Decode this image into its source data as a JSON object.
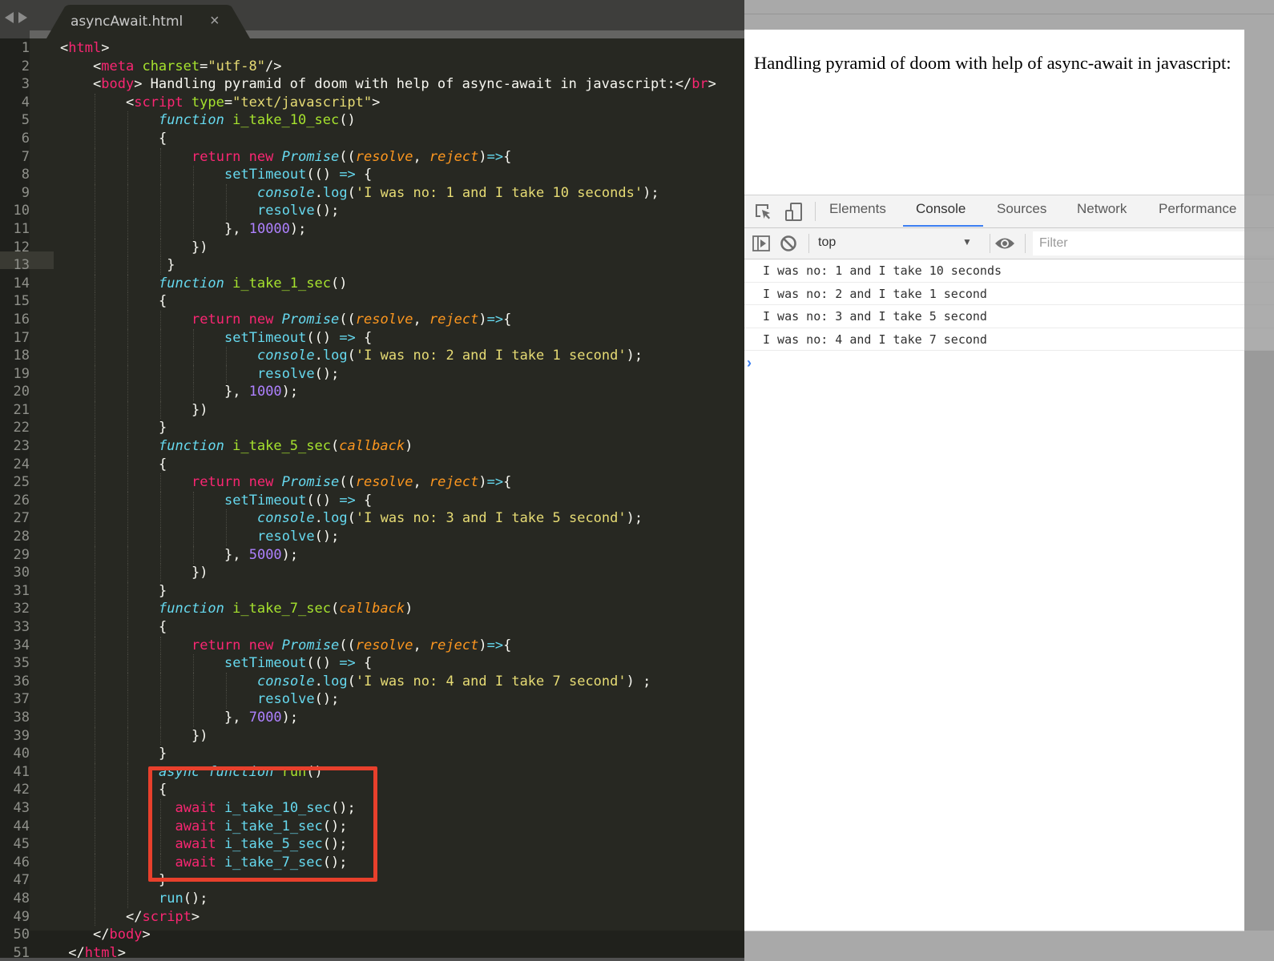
{
  "editor": {
    "tab_title": "asyncAwait.html",
    "tab_close_icon": "×",
    "lines": [
      {
        "n": "1",
        "indent": 0,
        "tokens": [
          [
            "pun",
            "<"
          ],
          [
            "tag",
            "html"
          ],
          [
            "pun",
            ">"
          ]
        ]
      },
      {
        "n": "2",
        "indent": 4,
        "tokens": [
          [
            "pun",
            "<"
          ],
          [
            "tag",
            "meta"
          ],
          [
            "pun",
            " "
          ],
          [
            "attr",
            "charset"
          ],
          [
            "pun",
            "="
          ],
          [
            "str",
            "\"utf-8\""
          ],
          [
            "pun",
            "/>"
          ]
        ]
      },
      {
        "n": "3",
        "indent": 4,
        "tokens": [
          [
            "pun",
            "<"
          ],
          [
            "tag",
            "body"
          ],
          [
            "pun",
            "> Handling pyramid of doom with help of async-await in javascript:</"
          ],
          [
            "tag",
            "br"
          ],
          [
            "pun",
            ">"
          ]
        ]
      },
      {
        "n": "4",
        "indent": 8,
        "tokens": [
          [
            "pun",
            "<"
          ],
          [
            "tag",
            "script"
          ],
          [
            "pun",
            " "
          ],
          [
            "attr",
            "type"
          ],
          [
            "pun",
            "="
          ],
          [
            "str",
            "\"text/javascript\""
          ],
          [
            "pun",
            ">"
          ]
        ]
      },
      {
        "n": "5",
        "indent": 12,
        "tokens": [
          [
            "sto",
            "function"
          ],
          [
            "pun",
            " "
          ],
          [
            "fn",
            "i_take_10_sec"
          ],
          [
            "pun",
            "()"
          ]
        ]
      },
      {
        "n": "6",
        "indent": 12,
        "tokens": [
          [
            "pun",
            "{"
          ]
        ]
      },
      {
        "n": "7",
        "indent": 16,
        "tokens": [
          [
            "kw",
            "return"
          ],
          [
            "pun",
            " "
          ],
          [
            "kw",
            "new"
          ],
          [
            "pun",
            " "
          ],
          [
            "cls",
            "Promise"
          ],
          [
            "pun",
            "(("
          ],
          [
            "param",
            "resolve"
          ],
          [
            "pun",
            ", "
          ],
          [
            "param",
            "reject"
          ],
          [
            "pun",
            ")"
          ],
          [
            "arrow",
            "=>"
          ],
          [
            "pun",
            "{"
          ]
        ]
      },
      {
        "n": "8",
        "indent": 20,
        "tokens": [
          [
            "call",
            "setTimeout"
          ],
          [
            "pun",
            "(() "
          ],
          [
            "arrow",
            "=>"
          ],
          [
            "pun",
            " {"
          ]
        ]
      },
      {
        "n": "9",
        "indent": 24,
        "tokens": [
          [
            "sto",
            "console"
          ],
          [
            "pun",
            "."
          ],
          [
            "call",
            "log"
          ],
          [
            "pun",
            "("
          ],
          [
            "str",
            "'I was no: 1 and I take 10 seconds'"
          ],
          [
            "pun",
            ");"
          ]
        ]
      },
      {
        "n": "10",
        "indent": 24,
        "tokens": [
          [
            "call",
            "resolve"
          ],
          [
            "pun",
            "();"
          ]
        ]
      },
      {
        "n": "11",
        "indent": 20,
        "tokens": [
          [
            "pun",
            "}, "
          ],
          [
            "num",
            "10000"
          ],
          [
            "pun",
            ");"
          ]
        ]
      },
      {
        "n": "12",
        "indent": 16,
        "tokens": [
          [
            "pun",
            "})"
          ]
        ]
      },
      {
        "n": "13",
        "indent": 13,
        "tokens": [
          [
            "pun",
            "}"
          ]
        ]
      },
      {
        "n": "14",
        "indent": 12,
        "tokens": [
          [
            "sto",
            "function"
          ],
          [
            "pun",
            " "
          ],
          [
            "fn",
            "i_take_1_sec"
          ],
          [
            "pun",
            "()"
          ]
        ]
      },
      {
        "n": "15",
        "indent": 12,
        "tokens": [
          [
            "pun",
            "{"
          ]
        ]
      },
      {
        "n": "16",
        "indent": 16,
        "tokens": [
          [
            "kw",
            "return"
          ],
          [
            "pun",
            " "
          ],
          [
            "kw",
            "new"
          ],
          [
            "pun",
            " "
          ],
          [
            "cls",
            "Promise"
          ],
          [
            "pun",
            "(("
          ],
          [
            "param",
            "resolve"
          ],
          [
            "pun",
            ", "
          ],
          [
            "param",
            "reject"
          ],
          [
            "pun",
            ")"
          ],
          [
            "arrow",
            "=>"
          ],
          [
            "pun",
            "{"
          ]
        ]
      },
      {
        "n": "17",
        "indent": 20,
        "tokens": [
          [
            "call",
            "setTimeout"
          ],
          [
            "pun",
            "(() "
          ],
          [
            "arrow",
            "=>"
          ],
          [
            "pun",
            " {"
          ]
        ]
      },
      {
        "n": "18",
        "indent": 24,
        "tokens": [
          [
            "sto",
            "console"
          ],
          [
            "pun",
            "."
          ],
          [
            "call",
            "log"
          ],
          [
            "pun",
            "("
          ],
          [
            "str",
            "'I was no: 2 and I take 1 second'"
          ],
          [
            "pun",
            ");"
          ]
        ]
      },
      {
        "n": "19",
        "indent": 24,
        "tokens": [
          [
            "call",
            "resolve"
          ],
          [
            "pun",
            "();"
          ]
        ]
      },
      {
        "n": "20",
        "indent": 20,
        "tokens": [
          [
            "pun",
            "}, "
          ],
          [
            "num",
            "1000"
          ],
          [
            "pun",
            ");"
          ]
        ]
      },
      {
        "n": "21",
        "indent": 16,
        "tokens": [
          [
            "pun",
            "})"
          ]
        ]
      },
      {
        "n": "22",
        "indent": 12,
        "tokens": [
          [
            "pun",
            "}"
          ]
        ]
      },
      {
        "n": "23",
        "indent": 12,
        "tokens": [
          [
            "sto",
            "function"
          ],
          [
            "pun",
            " "
          ],
          [
            "fn",
            "i_take_5_sec"
          ],
          [
            "pun",
            "("
          ],
          [
            "param",
            "callback"
          ],
          [
            "pun",
            ")"
          ]
        ]
      },
      {
        "n": "24",
        "indent": 12,
        "tokens": [
          [
            "pun",
            "{"
          ]
        ]
      },
      {
        "n": "25",
        "indent": 16,
        "tokens": [
          [
            "kw",
            "return"
          ],
          [
            "pun",
            " "
          ],
          [
            "kw",
            "new"
          ],
          [
            "pun",
            " "
          ],
          [
            "cls",
            "Promise"
          ],
          [
            "pun",
            "(("
          ],
          [
            "param",
            "resolve"
          ],
          [
            "pun",
            ", "
          ],
          [
            "param",
            "reject"
          ],
          [
            "pun",
            ")"
          ],
          [
            "arrow",
            "=>"
          ],
          [
            "pun",
            "{"
          ]
        ]
      },
      {
        "n": "26",
        "indent": 20,
        "tokens": [
          [
            "call",
            "setTimeout"
          ],
          [
            "pun",
            "(() "
          ],
          [
            "arrow",
            "=>"
          ],
          [
            "pun",
            " {"
          ]
        ]
      },
      {
        "n": "27",
        "indent": 24,
        "tokens": [
          [
            "sto",
            "console"
          ],
          [
            "pun",
            "."
          ],
          [
            "call",
            "log"
          ],
          [
            "pun",
            "("
          ],
          [
            "str",
            "'I was no: 3 and I take 5 second'"
          ],
          [
            "pun",
            ");"
          ]
        ]
      },
      {
        "n": "28",
        "indent": 24,
        "tokens": [
          [
            "call",
            "resolve"
          ],
          [
            "pun",
            "();"
          ]
        ]
      },
      {
        "n": "29",
        "indent": 20,
        "tokens": [
          [
            "pun",
            "}, "
          ],
          [
            "num",
            "5000"
          ],
          [
            "pun",
            ");"
          ]
        ]
      },
      {
        "n": "30",
        "indent": 16,
        "tokens": [
          [
            "pun",
            "})"
          ]
        ]
      },
      {
        "n": "31",
        "indent": 12,
        "tokens": [
          [
            "pun",
            "}"
          ]
        ]
      },
      {
        "n": "32",
        "indent": 12,
        "tokens": [
          [
            "sto",
            "function"
          ],
          [
            "pun",
            " "
          ],
          [
            "fn",
            "i_take_7_sec"
          ],
          [
            "pun",
            "("
          ],
          [
            "param",
            "callback"
          ],
          [
            "pun",
            ")"
          ]
        ]
      },
      {
        "n": "33",
        "indent": 12,
        "tokens": [
          [
            "pun",
            "{"
          ]
        ]
      },
      {
        "n": "34",
        "indent": 16,
        "tokens": [
          [
            "kw",
            "return"
          ],
          [
            "pun",
            " "
          ],
          [
            "kw",
            "new"
          ],
          [
            "pun",
            " "
          ],
          [
            "cls",
            "Promise"
          ],
          [
            "pun",
            "(("
          ],
          [
            "param",
            "resolve"
          ],
          [
            "pun",
            ", "
          ],
          [
            "param",
            "reject"
          ],
          [
            "pun",
            ")"
          ],
          [
            "arrow",
            "=>"
          ],
          [
            "pun",
            "{"
          ]
        ]
      },
      {
        "n": "35",
        "indent": 20,
        "tokens": [
          [
            "call",
            "setTimeout"
          ],
          [
            "pun",
            "(() "
          ],
          [
            "arrow",
            "=>"
          ],
          [
            "pun",
            " {"
          ]
        ]
      },
      {
        "n": "36",
        "indent": 24,
        "tokens": [
          [
            "sto",
            "console"
          ],
          [
            "pun",
            "."
          ],
          [
            "call",
            "log"
          ],
          [
            "pun",
            "("
          ],
          [
            "str",
            "'I was no: 4 and I take 7 second'"
          ],
          [
            "pun",
            ") ;"
          ]
        ]
      },
      {
        "n": "37",
        "indent": 24,
        "tokens": [
          [
            "call",
            "resolve"
          ],
          [
            "pun",
            "();"
          ]
        ]
      },
      {
        "n": "38",
        "indent": 20,
        "tokens": [
          [
            "pun",
            "}, "
          ],
          [
            "num",
            "7000"
          ],
          [
            "pun",
            ");"
          ]
        ]
      },
      {
        "n": "39",
        "indent": 16,
        "tokens": [
          [
            "pun",
            "})"
          ]
        ]
      },
      {
        "n": "40",
        "indent": 12,
        "tokens": [
          [
            "pun",
            "}"
          ]
        ]
      },
      {
        "n": "41",
        "indent": 12,
        "tokens": [
          [
            "sto",
            "async"
          ],
          [
            "pun",
            " "
          ],
          [
            "sto",
            "function"
          ],
          [
            "pun",
            " "
          ],
          [
            "fn",
            "run"
          ],
          [
            "pun",
            "()"
          ]
        ]
      },
      {
        "n": "42",
        "indent": 12,
        "tokens": [
          [
            "pun",
            "{"
          ]
        ]
      },
      {
        "n": "43",
        "indent": 14,
        "tokens": [
          [
            "kw",
            "await"
          ],
          [
            "pun",
            " "
          ],
          [
            "call",
            "i_take_10_sec"
          ],
          [
            "pun",
            "();"
          ]
        ]
      },
      {
        "n": "44",
        "indent": 14,
        "tokens": [
          [
            "kw",
            "await"
          ],
          [
            "pun",
            " "
          ],
          [
            "call",
            "i_take_1_sec"
          ],
          [
            "pun",
            "();"
          ]
        ]
      },
      {
        "n": "45",
        "indent": 14,
        "tokens": [
          [
            "kw",
            "await"
          ],
          [
            "pun",
            " "
          ],
          [
            "call",
            "i_take_5_sec"
          ],
          [
            "pun",
            "();"
          ]
        ]
      },
      {
        "n": "46",
        "indent": 14,
        "tokens": [
          [
            "kw",
            "await"
          ],
          [
            "pun",
            " "
          ],
          [
            "call",
            "i_take_7_sec"
          ],
          [
            "pun",
            "();"
          ]
        ]
      },
      {
        "n": "47",
        "indent": 12,
        "tokens": [
          [
            "pun",
            "}"
          ]
        ]
      },
      {
        "n": "48",
        "indent": 12,
        "tokens": [
          [
            "call",
            "run"
          ],
          [
            "pun",
            "();"
          ]
        ]
      },
      {
        "n": "49",
        "indent": 8,
        "tokens": [
          [
            "pun",
            "</"
          ],
          [
            "tag",
            "script"
          ],
          [
            "pun",
            ">"
          ]
        ]
      },
      {
        "n": "50",
        "indent": 4,
        "tokens": [
          [
            "pun",
            "</"
          ],
          [
            "tag",
            "body"
          ],
          [
            "pun",
            ">"
          ]
        ]
      },
      {
        "n": "51",
        "indent": 1,
        "tokens": [
          [
            "pun",
            "</"
          ],
          [
            "tag",
            "html"
          ],
          [
            "pun",
            ">"
          ]
        ]
      }
    ],
    "highlight_box_color": "#e8402c",
    "highlight_box_lines": "42-47"
  },
  "browser": {
    "page_text": "Handling pyramid of doom with help of async-await in javascript:",
    "devtools": {
      "icons": [
        "inspect-element-icon",
        "device-toolbar-icon"
      ],
      "tabs": [
        {
          "label": "Elements",
          "active": false
        },
        {
          "label": "Console",
          "active": true
        },
        {
          "label": "Sources",
          "active": false
        },
        {
          "label": "Network",
          "active": false
        },
        {
          "label": "Performance",
          "active": false
        }
      ],
      "accent_color": "#3c7ef1",
      "toolbar": {
        "context_value": "top",
        "filter_placeholder": "Filter",
        "filter_value": ""
      },
      "console_messages": [
        "I was no: 1 and I take 10 seconds",
        "I was no: 2 and I take 1 second",
        "I was no: 3 and I take 5 second",
        "I was no: 4 and I take 7 second"
      ],
      "prompt_glyph": "›"
    }
  }
}
